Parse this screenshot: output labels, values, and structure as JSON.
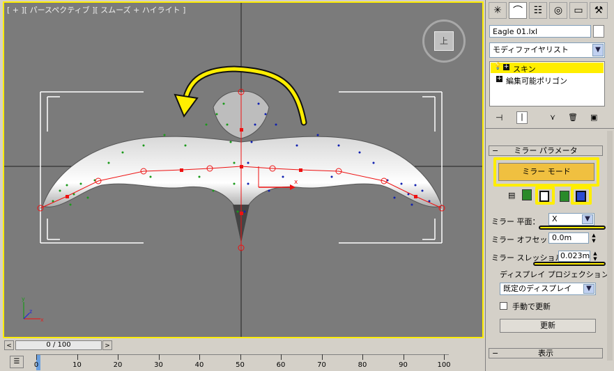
{
  "viewport": {
    "label": "[ + ][ パースペクティブ ][ スムーズ + ハイライト ]",
    "viewcube_face": "上"
  },
  "timebar": {
    "prev": "<",
    "next": ">",
    "frame": "0 / 100"
  },
  "ruler": {
    "ticks": [
      "0",
      "10",
      "20",
      "30",
      "40",
      "50",
      "60",
      "70",
      "80",
      "90",
      "100"
    ]
  },
  "panel": {
    "tabs": [
      {
        "name": "create-tab",
        "icon": "✳"
      },
      {
        "name": "modify-tab",
        "icon": "⌒"
      },
      {
        "name": "hierarchy-tab",
        "icon": "☷"
      },
      {
        "name": "motion-tab",
        "icon": "◎"
      },
      {
        "name": "display-tab",
        "icon": "▭"
      },
      {
        "name": "utilities-tab",
        "icon": "⚒"
      }
    ],
    "object_name": "Eagle 01.lxl",
    "modifier_list": "モディファイヤリスト",
    "stack": [
      {
        "label": "スキン",
        "selected": true
      },
      {
        "label": "編集可能ポリゴン",
        "selected": false
      }
    ],
    "mirror": {
      "header": "ミラー パラメータ",
      "mode_button": "ミラー モード",
      "plane_label": "ミラー 平面：",
      "plane_value": "X",
      "offset_label": "ミラー オフセット：",
      "offset_value": "0.0m",
      "threshold_label": "ミラー スレッショルド：",
      "threshold_value": "0.023m",
      "display_projection_label": "ディスプレイ プロジェクション",
      "display_projection_value": "既定のディスプレイ",
      "manual_update_label": "手動で更新",
      "update_button": "更新"
    },
    "display_header": "表示",
    "highlight_color": "#ffee00"
  }
}
